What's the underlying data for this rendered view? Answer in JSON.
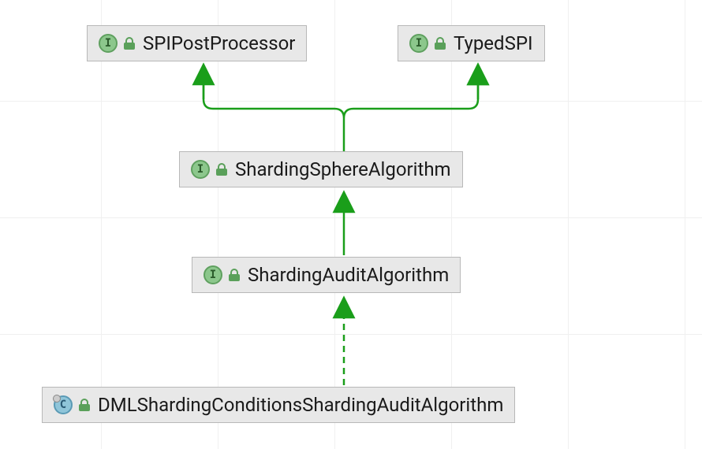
{
  "nodes": {
    "spi_post_processor": {
      "label": "SPIPostProcessor",
      "kind": "interface",
      "kind_letter": "I"
    },
    "typed_spi": {
      "label": "TypedSPI",
      "kind": "interface",
      "kind_letter": "I"
    },
    "sharding_sphere_algorithm": {
      "label": "ShardingSphereAlgorithm",
      "kind": "interface",
      "kind_letter": "I"
    },
    "sharding_audit_algorithm": {
      "label": "ShardingAuditAlgorithm",
      "kind": "interface",
      "kind_letter": "I"
    },
    "dml_sharding_conditions": {
      "label": "DMLShardingConditionsShardingAuditAlgorithm",
      "kind": "class",
      "kind_letter": "C"
    }
  },
  "edges": [
    {
      "from": "sharding_sphere_algorithm",
      "to": "spi_post_processor",
      "style": "solid"
    },
    {
      "from": "sharding_sphere_algorithm",
      "to": "typed_spi",
      "style": "solid"
    },
    {
      "from": "sharding_audit_algorithm",
      "to": "sharding_sphere_algorithm",
      "style": "solid"
    },
    {
      "from": "dml_sharding_conditions",
      "to": "sharding_audit_algorithm",
      "style": "dashed"
    }
  ],
  "colors": {
    "arrow": "#1a9e1a",
    "node_bg": "#e8e8e8",
    "node_border": "#b8b8b8"
  }
}
